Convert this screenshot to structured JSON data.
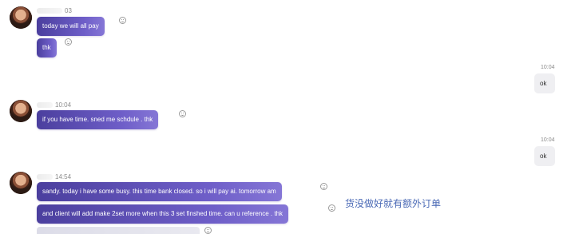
{
  "messages": [
    {
      "id": "m1",
      "time": "03",
      "text": "today we will all pay"
    },
    {
      "id": "m2",
      "text": "thk"
    },
    {
      "id": "m3",
      "time": "10:04",
      "text": "ok",
      "outgoing": true
    },
    {
      "id": "m4",
      "time": "10:04",
      "text": "if you have time. sned me schdule . thk"
    },
    {
      "id": "m5",
      "time": "10:04",
      "text": "ok",
      "outgoing": true
    },
    {
      "id": "m6",
      "time": "14:54",
      "text": "sandy. today i have some busy. this time bank closed. so i will pay ai. tomorrow am"
    },
    {
      "id": "m7",
      "text": "and client will add make 2set more when this 3 set finshed time. can u reference . thk"
    }
  ],
  "annotation": "货没做好就有额外订单"
}
